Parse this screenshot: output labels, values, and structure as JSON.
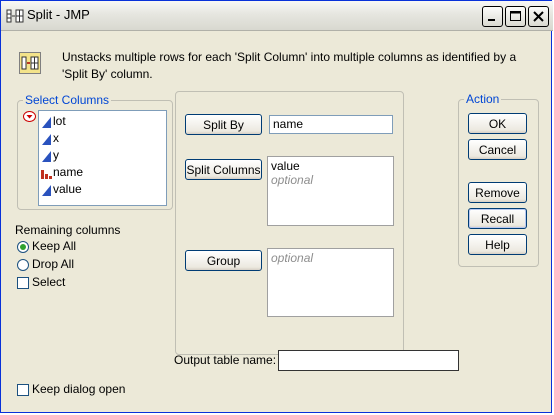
{
  "window": {
    "title": "Split - JMP",
    "title_icon": "split-icon",
    "controls": [
      "minimize-icon",
      "maximize-icon",
      "close-icon"
    ]
  },
  "description": "Unstacks multiple rows for each 'Split Column' into multiple columns as identified by a 'Split By' column.",
  "select_columns": {
    "label": "Select Columns",
    "columns": [
      {
        "name": "lot",
        "type_icon": "continuous-column-icon"
      },
      {
        "name": "x",
        "type_icon": "continuous-column-icon"
      },
      {
        "name": "y",
        "type_icon": "continuous-column-icon"
      },
      {
        "name": "name",
        "type_icon": "nominal-column-icon"
      },
      {
        "name": "value",
        "type_icon": "continuous-column-icon"
      }
    ]
  },
  "remaining_columns": {
    "label": "Remaining columns",
    "options": [
      {
        "label": "Keep All",
        "checked": true
      },
      {
        "label": "Drop All",
        "checked": false
      }
    ],
    "select_label": "Select"
  },
  "roles": {
    "split_by": {
      "button": "Split By",
      "value": "name"
    },
    "split_columns": {
      "button": "Split Columns",
      "values": [
        "value"
      ],
      "placeholder": "optional"
    },
    "group": {
      "button": "Group",
      "placeholder": "optional"
    }
  },
  "output_table": {
    "label": "Output table name:",
    "value": ""
  },
  "keep_dialog_open": {
    "label": "Keep dialog open",
    "checked": false
  },
  "action": {
    "label": "Action",
    "buttons": [
      "OK",
      "Cancel",
      "Remove",
      "Recall",
      "Help"
    ]
  },
  "colors": {
    "accent": "#0046d5",
    "titlebar": "#e6e6e0",
    "dialog_bg": "#ece9d8"
  }
}
